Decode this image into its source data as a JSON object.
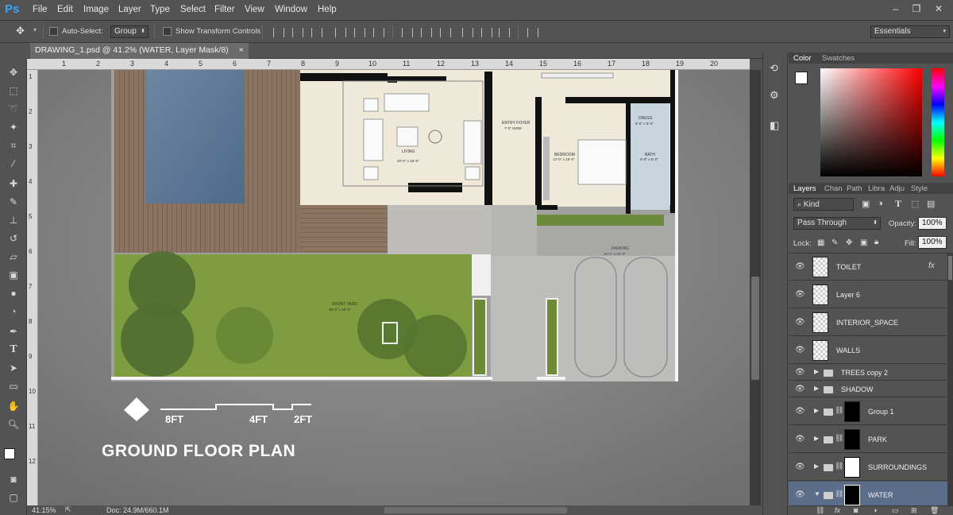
{
  "app": {
    "logo": "Ps"
  },
  "menu": [
    "File",
    "Edit",
    "Image",
    "Layer",
    "Type",
    "Select",
    "Filter",
    "View",
    "Window",
    "Help"
  ],
  "window_controls": {
    "minimize": "–",
    "restore": "❐",
    "close": "✕"
  },
  "options": {
    "auto_select_label": "Auto-Select:",
    "auto_select_value": "Group",
    "transform_label": "Show Transform Controls",
    "workspace": "Essentials"
  },
  "document": {
    "tab_title": "DRAWING_1.psd @ 41.2% (WATER, Layer Mask/8)",
    "tab_close": "×"
  },
  "ruler": {
    "top": [
      "1",
      "2",
      "3",
      "4",
      "5",
      "6",
      "7",
      "8",
      "9",
      "10",
      "11",
      "12",
      "13",
      "14",
      "15",
      "16",
      "17",
      "18",
      "19",
      "20"
    ],
    "left": [
      "1",
      "2",
      "3",
      "4",
      "5",
      "6",
      "7",
      "8",
      "9",
      "10",
      "11",
      "12"
    ]
  },
  "plan": {
    "title": "GROUND FLOOR PLAN",
    "scale": [
      "8FT",
      "4FT",
      "2FT"
    ],
    "labels": {
      "entry": "ENTRY FOYER",
      "entry_dim": "7'-0\" WIDE",
      "living": "LIVING",
      "living_dim": "20'-0\" x 16'-0\"",
      "bedroom": "BEDROOM",
      "bedroom_dim": "12'-0\" x 15'-0\"",
      "dress": "DRESS",
      "dress_dim": "6'-0\" x 5'-0\"",
      "bath": "BATH",
      "bath_dim": "6'-0\" x 5'-0\"",
      "parking": "PARKING",
      "parking_dim": "16'-0\" x 20'-0\"",
      "front_yard": "FRONT YARD",
      "front_yard_dim": "45'-0\" x 20'-0\""
    }
  },
  "status": {
    "zoom": "41.15%",
    "doc": "Doc: 24.9M/660.1M"
  },
  "panel": {
    "color_tabs": [
      "Color",
      "Swatches"
    ],
    "layer_tabs": [
      "Layers",
      "Chan",
      "Path",
      "Libra",
      "Adju",
      "Style"
    ],
    "filter_kind": "Kind",
    "blend_mode": "Pass Through",
    "opacity_label": "Opacity:",
    "opacity_value": "100%",
    "lock_label": "Lock:",
    "fill_label": "Fill:",
    "fill_value": "100%",
    "layers": [
      {
        "name": "TOILET",
        "type": "layer",
        "fx": "fx"
      },
      {
        "name": "Layer 6",
        "type": "layer"
      },
      {
        "name": "INTERIOR_SPACE",
        "type": "layer"
      },
      {
        "name": "WALLS",
        "type": "layer"
      },
      {
        "name": "TREES copy 2",
        "type": "group"
      },
      {
        "name": "SHADOW",
        "type": "group"
      },
      {
        "name": "Group 1",
        "type": "group-mask"
      },
      {
        "name": "PARK",
        "type": "group-mask"
      },
      {
        "name": "SURROUNDINGS",
        "type": "group-mask"
      },
      {
        "name": "WATER",
        "type": "group-mask",
        "selected": true
      }
    ]
  },
  "colors": {
    "accent": "#31a8ff",
    "selected_layer": "#5a6e8a"
  }
}
